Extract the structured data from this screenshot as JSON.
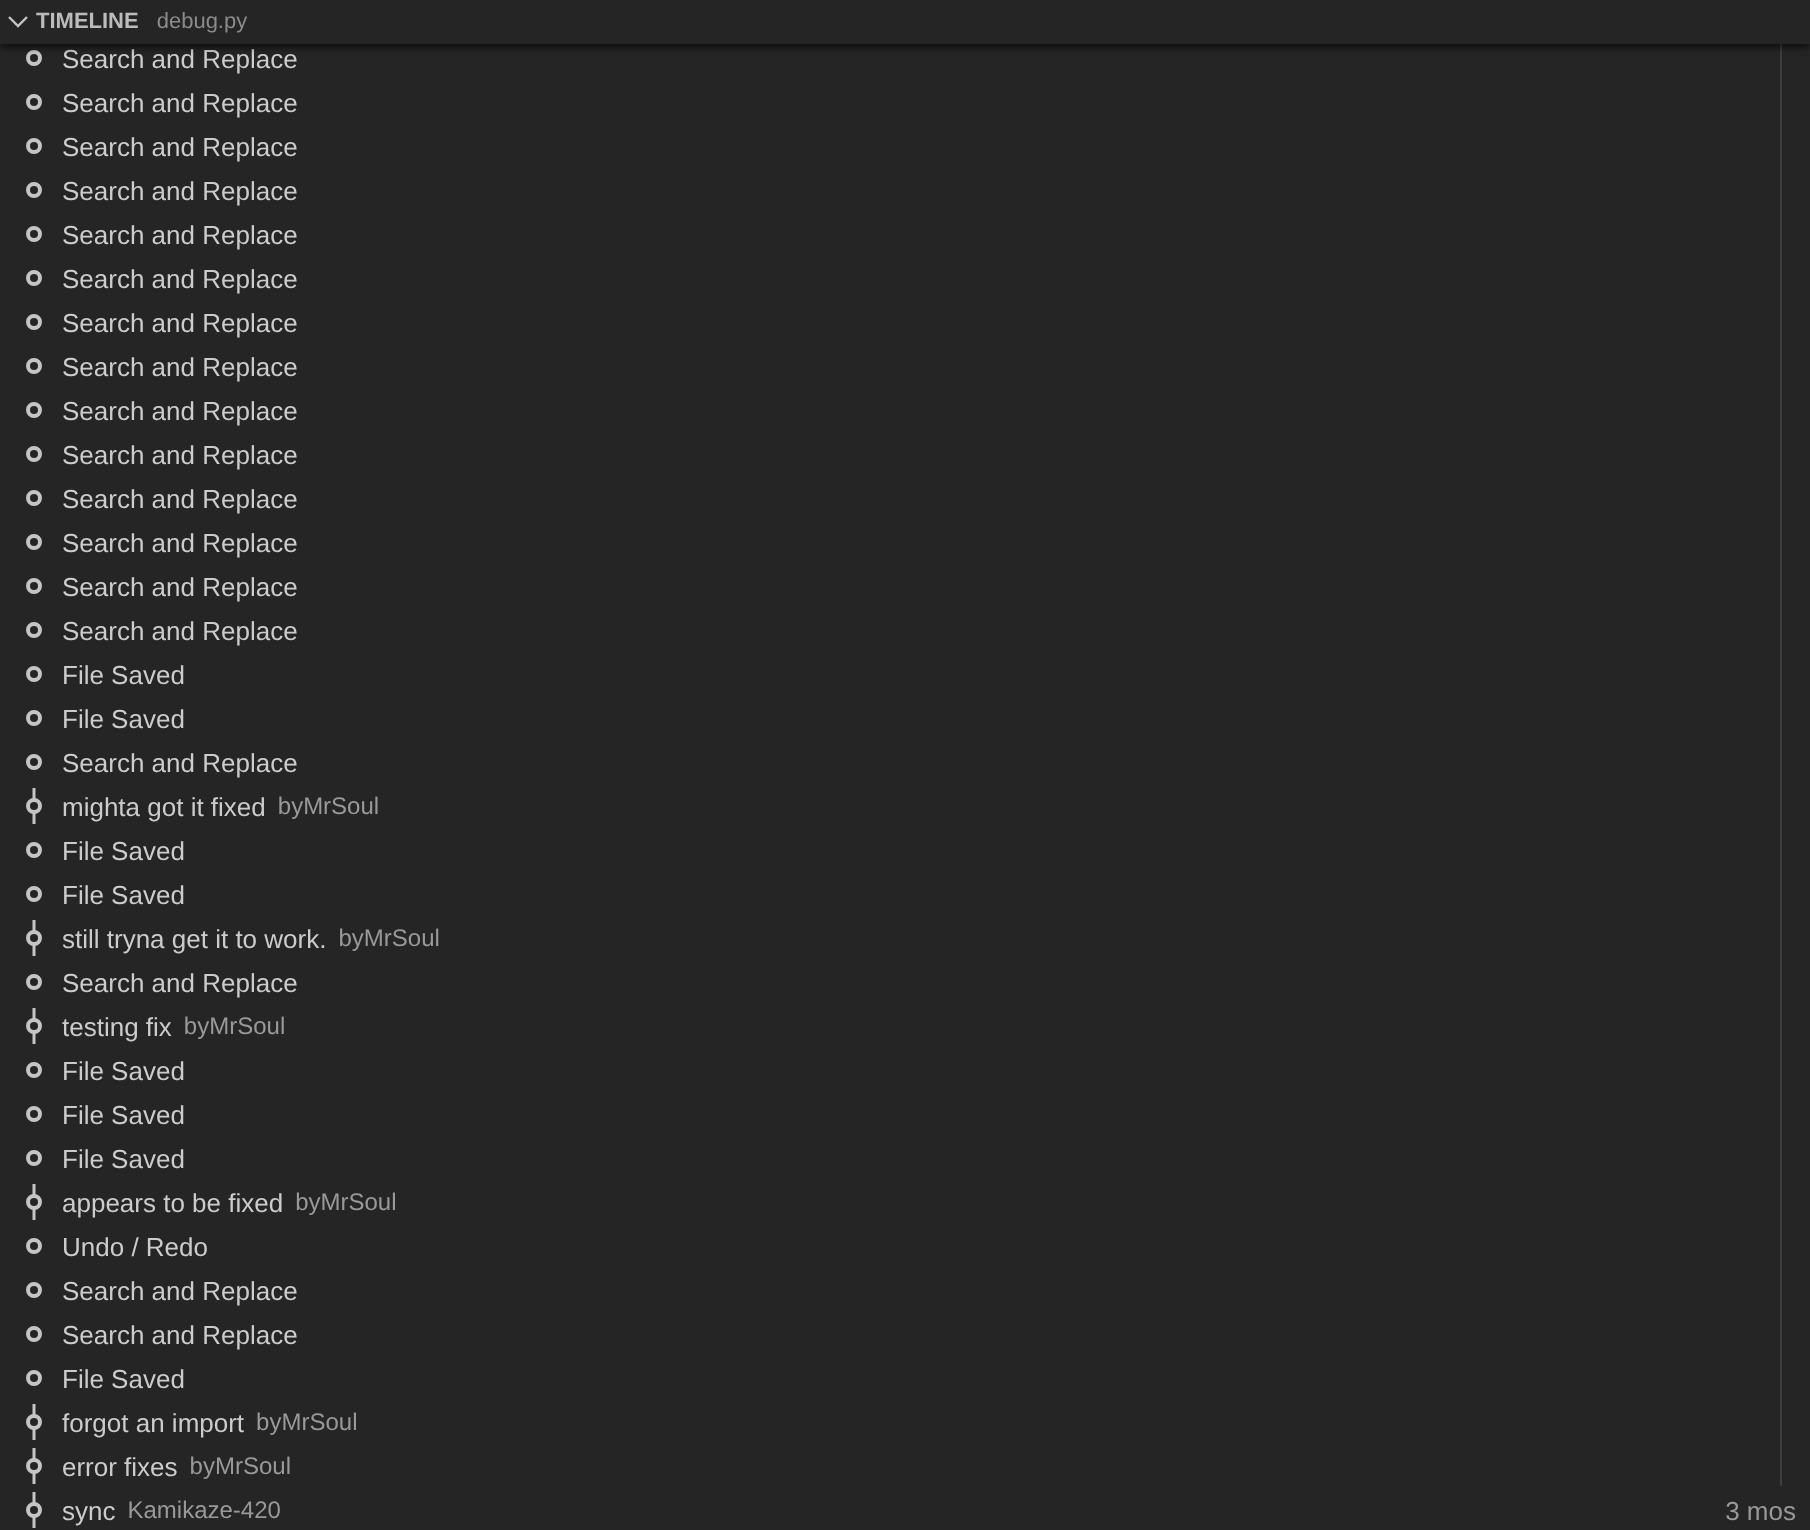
{
  "panel": {
    "title": "TIMELINE",
    "file": "debug.py",
    "expanded": true
  },
  "items": [
    {
      "kind": "local",
      "label": "Search and Replace"
    },
    {
      "kind": "local",
      "label": "Search and Replace"
    },
    {
      "kind": "local",
      "label": "Search and Replace"
    },
    {
      "kind": "local",
      "label": "Search and Replace"
    },
    {
      "kind": "local",
      "label": "Search and Replace"
    },
    {
      "kind": "local",
      "label": "Search and Replace"
    },
    {
      "kind": "local",
      "label": "Search and Replace"
    },
    {
      "kind": "local",
      "label": "Search and Replace"
    },
    {
      "kind": "local",
      "label": "Search and Replace"
    },
    {
      "kind": "local",
      "label": "Search and Replace"
    },
    {
      "kind": "local",
      "label": "Search and Replace"
    },
    {
      "kind": "local",
      "label": "Search and Replace"
    },
    {
      "kind": "local",
      "label": "Search and Replace"
    },
    {
      "kind": "local",
      "label": "Search and Replace"
    },
    {
      "kind": "local",
      "label": "File Saved"
    },
    {
      "kind": "local",
      "label": "File Saved"
    },
    {
      "kind": "local",
      "label": "Search and Replace"
    },
    {
      "kind": "commit",
      "label": "mighta got it fixed",
      "author": "byMrSoul"
    },
    {
      "kind": "local",
      "label": "File Saved"
    },
    {
      "kind": "local",
      "label": "File Saved"
    },
    {
      "kind": "commit",
      "label": "still tryna get it to work.",
      "author": "byMrSoul"
    },
    {
      "kind": "local",
      "label": "Search and Replace"
    },
    {
      "kind": "commit",
      "label": "testing fix",
      "author": "byMrSoul"
    },
    {
      "kind": "local",
      "label": "File Saved"
    },
    {
      "kind": "local",
      "label": "File Saved"
    },
    {
      "kind": "local",
      "label": "File Saved"
    },
    {
      "kind": "commit",
      "label": "appears to be fixed",
      "author": "byMrSoul"
    },
    {
      "kind": "local",
      "label": "Undo / Redo"
    },
    {
      "kind": "local",
      "label": "Search and Replace"
    },
    {
      "kind": "local",
      "label": "Search and Replace"
    },
    {
      "kind": "local",
      "label": "File Saved"
    },
    {
      "kind": "commit",
      "label": "forgot an import",
      "author": "byMrSoul"
    },
    {
      "kind": "commit",
      "label": "error fixes",
      "author": "byMrSoul"
    },
    {
      "kind": "commit",
      "label": "sync",
      "author": "Kamikaze-420",
      "time": "3 mos"
    }
  ]
}
